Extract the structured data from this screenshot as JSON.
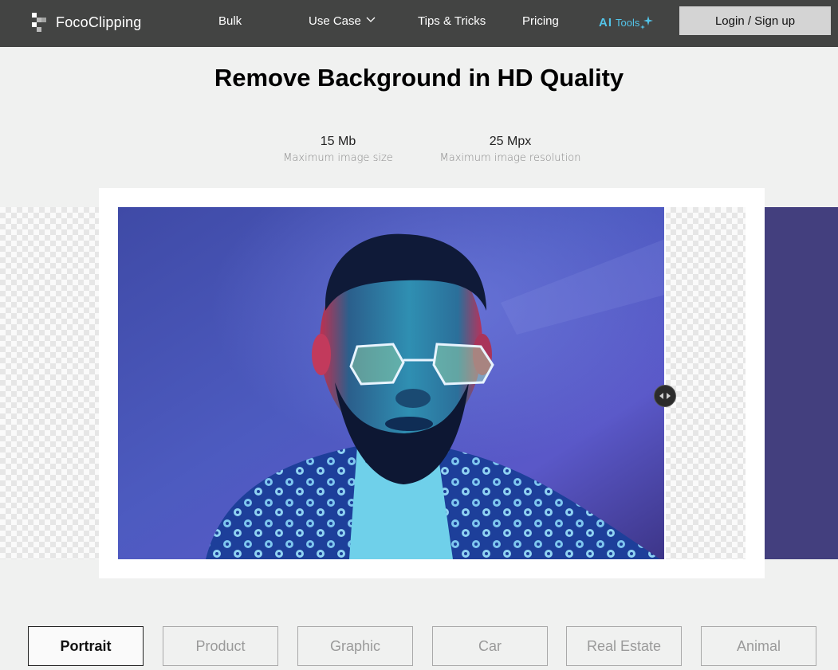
{
  "header": {
    "brand": "FocoClipping",
    "nav": {
      "bulk": "Bulk",
      "use_case": "Use Case",
      "tips": "Tips & Tricks",
      "pricing": "Pricing",
      "ai_prefix": "AI",
      "ai_tools": "Tools"
    },
    "login_label": "Login / Sign up"
  },
  "hero": {
    "title": "Remove Background in HD Quality",
    "stats": [
      {
        "value": "15 Mb",
        "label": "Maximum image size"
      },
      {
        "value": "25 Mpx",
        "label": "Maximum image resolution"
      }
    ]
  },
  "showcase": {
    "comparison_position": 0.82,
    "photo_background_color": "#433f7e"
  },
  "categories": {
    "active": "Portrait",
    "items": [
      "Portrait",
      "Product",
      "Graphic",
      "Car",
      "Real Estate",
      "Animal"
    ]
  },
  "icons": {
    "logo": "fococlipping-logo-icon",
    "dropdown": "chevron-down-icon",
    "sparkle": "sparkle-icon",
    "slider": "compare-slider-icon"
  },
  "colors": {
    "header_bg": "#434443",
    "ai_accent": "#53c4e8",
    "login_bg": "#d4d4d4",
    "page_bg": "#f0f1f0"
  }
}
